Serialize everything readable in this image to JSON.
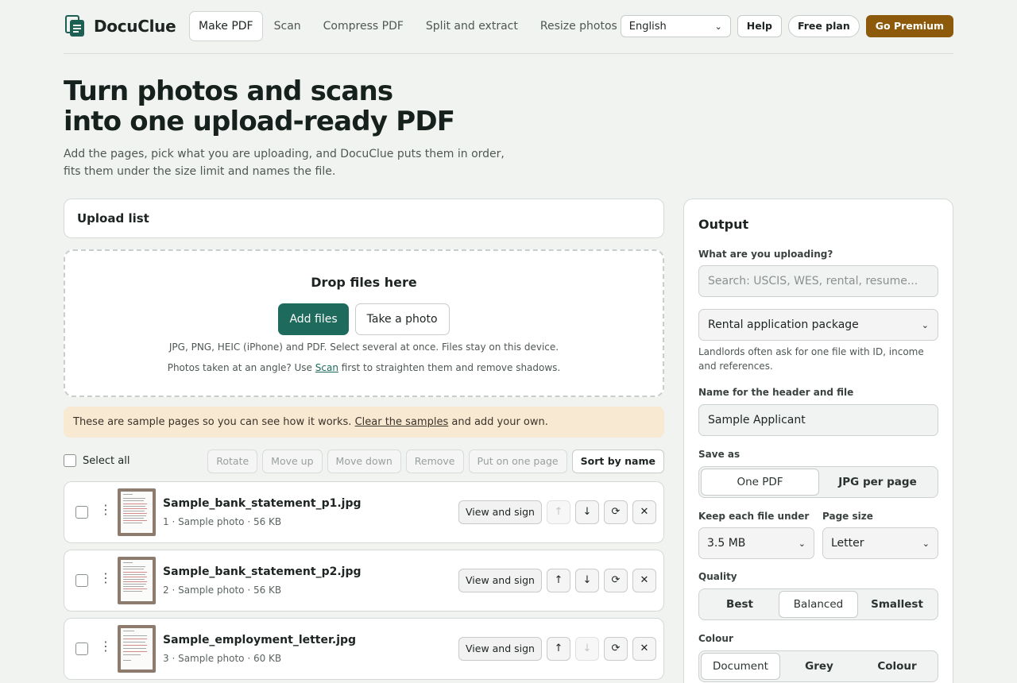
{
  "brand": {
    "name": "DocuClue"
  },
  "nav": [
    {
      "label": "Make PDF",
      "active": true
    },
    {
      "label": "Scan"
    },
    {
      "label": "Compress PDF"
    },
    {
      "label": "Split and extract"
    },
    {
      "label": "Resize photos"
    }
  ],
  "header": {
    "language": "English",
    "help": "Help",
    "plan": "Free plan",
    "premium": "Go Premium"
  },
  "hero": {
    "title_line1": "Turn photos and scans",
    "title_line2": "into one upload-ready PDF",
    "sub_line1": "Add the pages, pick what you are uploading, and DocuClue puts them in order,",
    "sub_line2": "fits them under the size limit and names the file."
  },
  "upload": {
    "title": "Upload list",
    "drop_title": "Drop files here",
    "add_files": "Add files",
    "take_photo": "Take a photo",
    "note1": "JPG, PNG, HEIC (iPhone) and PDF. Select several at once. Files stay on this device.",
    "note2_pre": "Photos taken at an angle? Use",
    "note2_link": "Scan",
    "note2_post": "first to straighten them and remove shadows.",
    "banner_pre": "These are sample pages so you can see how it works.",
    "banner_link": "Clear the samples",
    "banner_post": "and add your own.",
    "select_all": "Select all",
    "tools": [
      "Rotate",
      "Move up",
      "Move down",
      "Remove",
      "Put on one page",
      "Sort by name"
    ],
    "row_actions": {
      "view": "View and sign",
      "up": "↑",
      "down": "↓",
      "rotate": "⟳",
      "remove": "✕"
    },
    "files": [
      {
        "name": "Sample_bank_statement_p1.jpg",
        "meta": "1 · Sample photo · 56 KB"
      },
      {
        "name": "Sample_bank_statement_p2.jpg",
        "meta": "2 · Sample photo · 56 KB"
      },
      {
        "name": "Sample_employment_letter.jpg",
        "meta": "3 · Sample photo · 60 KB"
      }
    ]
  },
  "output": {
    "title": "Output",
    "what_label": "What are you uploading?",
    "search_placeholder": "Search: USCIS, WES, rental, resume...",
    "preset": "Rental application package",
    "preset_help": "Landlords often ask for one file with ID, income and references.",
    "name_label": "Name for the header and file",
    "name_value": "Sample Applicant",
    "saveas_label": "Save as",
    "saveas": [
      "One PDF",
      "JPG per page"
    ],
    "keep_label": "Keep each file under",
    "keep_value": "3.5 MB",
    "pagesize_label": "Page size",
    "pagesize_value": "Letter",
    "quality_label": "Quality",
    "quality": [
      "Best",
      "Balanced",
      "Smallest"
    ],
    "colour_label": "Colour",
    "colour": [
      "Document",
      "Grey",
      "Colour"
    ]
  }
}
